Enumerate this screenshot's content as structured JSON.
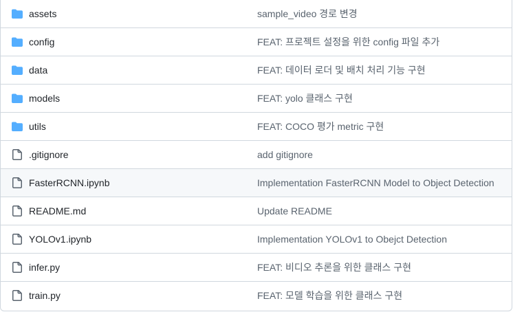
{
  "colors": {
    "folder_icon": "#54aeff",
    "file_icon": "#59636e",
    "text": "#1f2328",
    "muted_text": "#59636e",
    "border": "#d0d7de",
    "hover_row": "#f6f8fa"
  },
  "files": [
    {
      "name": "assets",
      "type": "folder",
      "icon": "folder-icon",
      "commit": "sample_video 경로 변경"
    },
    {
      "name": "config",
      "type": "folder",
      "icon": "folder-icon",
      "commit": "FEAT: 프로젝트 설정을 위한 config 파일 추가"
    },
    {
      "name": "data",
      "type": "folder",
      "icon": "folder-icon",
      "commit": "FEAT: 데이터 로더 및 배치 처리 기능 구현"
    },
    {
      "name": "models",
      "type": "folder",
      "icon": "folder-icon",
      "commit": "FEAT: yolo 클래스 구현"
    },
    {
      "name": "utils",
      "type": "folder",
      "icon": "folder-icon",
      "commit": "FEAT: COCO 평가 metric 구현"
    },
    {
      "name": ".gitignore",
      "type": "file",
      "icon": "file-icon",
      "commit": "add gitignore"
    },
    {
      "name": "FasterRCNN.ipynb",
      "type": "file",
      "icon": "file-icon",
      "commit": "Implementation FasterRCNN Model to Object Detection",
      "hovered": true
    },
    {
      "name": "README.md",
      "type": "file",
      "icon": "file-icon",
      "commit": "Update README"
    },
    {
      "name": "YOLOv1.ipynb",
      "type": "file",
      "icon": "file-icon",
      "commit": "Implementation YOLOv1 to Obejct Detection"
    },
    {
      "name": "infer.py",
      "type": "file",
      "icon": "file-icon",
      "commit": "FEAT: 비디오 추론을 위한 클래스 구현"
    },
    {
      "name": "train.py",
      "type": "file",
      "icon": "file-icon",
      "commit": "FEAT: 모델 학습을 위한 클래스 구현"
    }
  ]
}
